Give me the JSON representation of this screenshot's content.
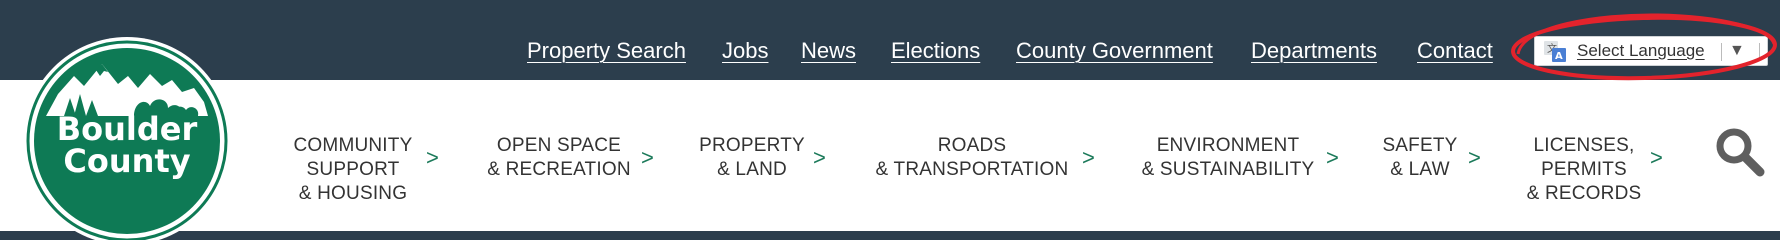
{
  "header": {
    "utility_links": [
      {
        "label": "Property Search"
      },
      {
        "label": "Jobs"
      },
      {
        "label": "News"
      },
      {
        "label": "Elections"
      },
      {
        "label": "County Government"
      },
      {
        "label": "Departments"
      },
      {
        "label": "Contact"
      }
    ],
    "translate": {
      "label": "Select Language",
      "arrow": "▼",
      "icon": "google-translate-icon"
    },
    "highlight_color": "#e3232c"
  },
  "logo": {
    "line1": "Boulder",
    "line2": "County",
    "color": "#0e7a55"
  },
  "main_nav": {
    "items": [
      {
        "label": "COMMUNITY\nSUPPORT\n& HOUSING",
        "arrow": ">"
      },
      {
        "label": "OPEN SPACE\n& RECREATION",
        "arrow": ">"
      },
      {
        "label": "PROPERTY\n& LAND",
        "arrow": ">"
      },
      {
        "label": "ROADS\n& TRANSPORTATION",
        "arrow": ">"
      },
      {
        "label": "ENVIRONMENT\n& SUSTAINABILITY",
        "arrow": ">"
      },
      {
        "label": "SAFETY\n& LAW",
        "arrow": ">"
      },
      {
        "label": "LICENSES,\nPERMITS\n& RECORDS",
        "arrow": ">"
      }
    ],
    "search_icon": "search-icon"
  },
  "colors": {
    "topbar": "#2c3e4d",
    "brand_green": "#0e7a55",
    "arrow_green": "#1c7a5a"
  }
}
